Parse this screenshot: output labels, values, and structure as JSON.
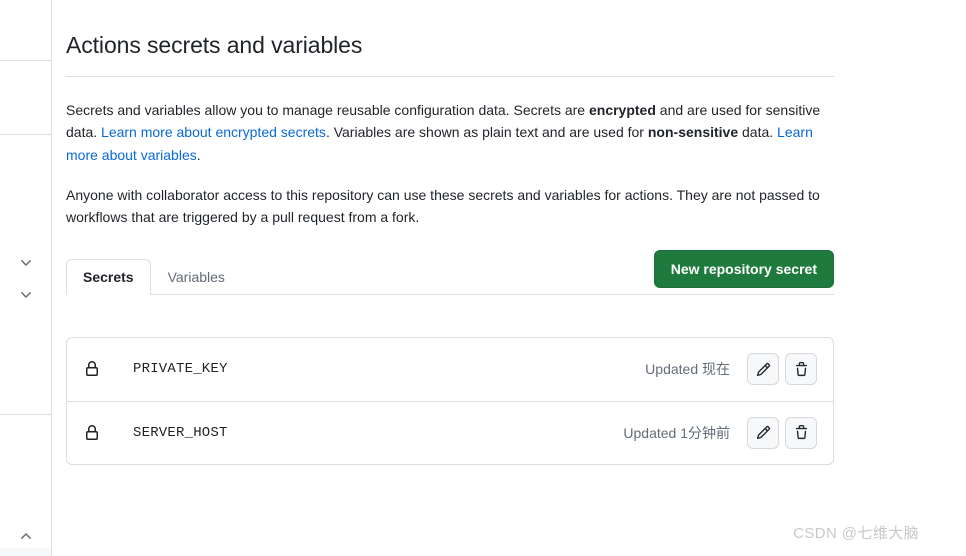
{
  "page": {
    "title": "Actions secrets and variables",
    "paragraph_1": {
      "segments": [
        {
          "type": "text",
          "value": "Secrets and variables allow you to manage reusable configuration data. Secrets are "
        },
        {
          "type": "bold",
          "value": "encrypted"
        },
        {
          "type": "text",
          "value": " and are used for sensitive data. "
        },
        {
          "type": "link",
          "value": "Learn more about encrypted secrets"
        },
        {
          "type": "text",
          "value": ". Variables are shown as plain text and are used for "
        },
        {
          "type": "bold",
          "value": "non-sensitive"
        },
        {
          "type": "text",
          "value": " data. "
        },
        {
          "type": "link",
          "value": "Learn more about variables"
        },
        {
          "type": "text",
          "value": "."
        }
      ],
      "plain_1": "Secrets and variables allow you to manage reusable configuration data. Secrets are ",
      "bold_1": "encrypted",
      "plain_2": " and are used for sensitive data. ",
      "link_1": "Learn more about encrypted secrets",
      "plain_3": ". Variables are shown as plain text and are used for ",
      "bold_2": "non-sensitive",
      "plain_4": " data. ",
      "link_2": "Learn more about variables",
      "plain_5": "."
    },
    "paragraph_2": "Anyone with collaborator access to this repository can use these secrets and variables for actions. They are not passed to workflows that are triggered by a pull request from a fork."
  },
  "tabs": [
    {
      "label": "Secrets",
      "selected": true
    },
    {
      "label": "Variables",
      "selected": false
    }
  ],
  "actions": {
    "new_secret_label": "New repository secret",
    "new_secret_color": "#1f7a3d"
  },
  "secrets": [
    {
      "name": "PRIVATE_KEY",
      "updated": "Updated 现在",
      "edit_label": "Edit",
      "delete_label": "Delete"
    },
    {
      "name": "SERVER_HOST",
      "updated": "Updated 1分钟前",
      "edit_label": "Edit",
      "delete_label": "Delete"
    }
  ],
  "sidebar": {
    "chevrons": [
      "chevron-down-icon",
      "chevron-down-icon",
      "chevron-up-icon"
    ]
  },
  "watermark": "CSDN @七维大脑",
  "colors": {
    "text": "#1f2328",
    "muted": "#636c76",
    "link": "#0969da",
    "border": "#d8dee4",
    "green": "#1f7a3d",
    "btn_bg": "#f6f8fa"
  }
}
